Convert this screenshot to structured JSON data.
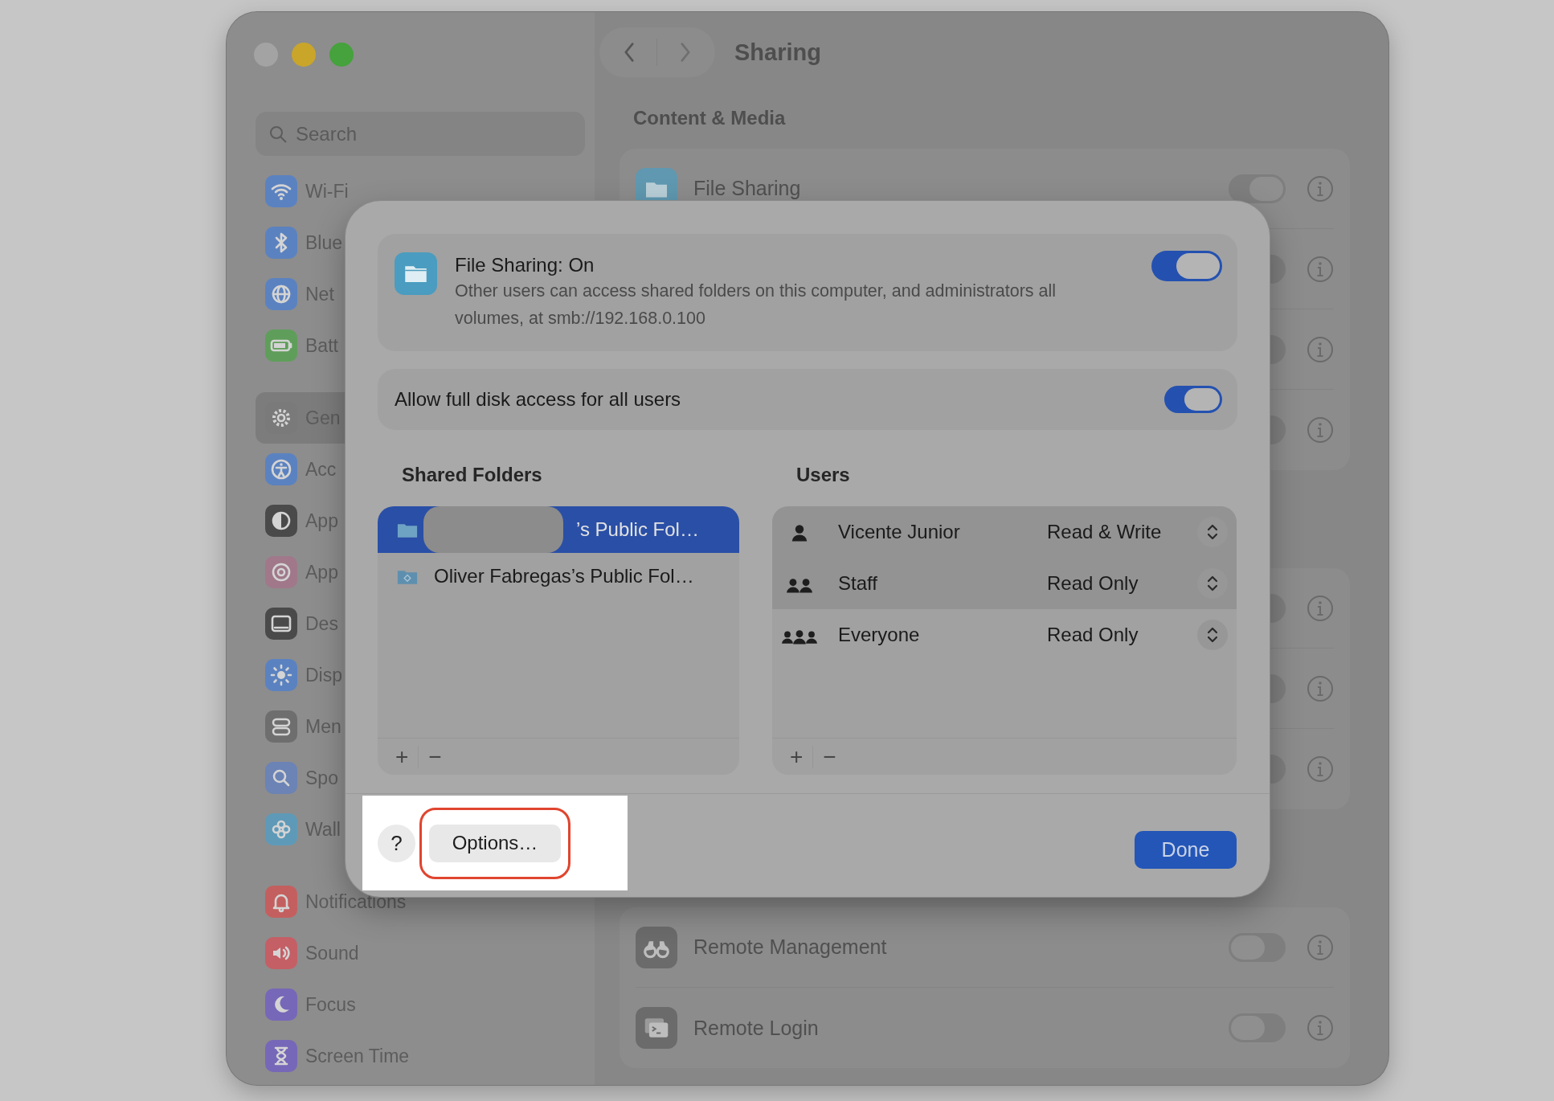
{
  "sidebar": {
    "search": {
      "placeholder": "Search"
    },
    "groups": [
      {
        "items": [
          {
            "label": "Wi-Fi",
            "kind": "wifi",
            "color": "#5b82c0",
            "selected": false
          },
          {
            "label": "Blue",
            "kind": "bluetooth",
            "color": "#5b82c0",
            "selected": false
          },
          {
            "label": "Net",
            "kind": "globe",
            "color": "#5b82c0",
            "selected": false
          },
          {
            "label": "Batt",
            "kind": "battery",
            "color": "#5f9e5a",
            "selected": false
          }
        ]
      },
      {
        "items": [
          {
            "label": "Gen",
            "kind": "gear",
            "color": "#7a7a7a",
            "selected": true
          },
          {
            "label": "Acc",
            "kind": "accessibility",
            "color": "#5b82c0",
            "selected": false
          },
          {
            "label": "App",
            "kind": "appearance",
            "color": "#4a4a4a",
            "selected": false
          },
          {
            "label": "App",
            "kind": "intelligence",
            "color": "#a0788a",
            "selected": false
          },
          {
            "label": "Des",
            "kind": "dock",
            "color": "#4a4a4a",
            "selected": false
          },
          {
            "label": "Disp",
            "kind": "sun",
            "color": "#5b82c0",
            "selected": false
          },
          {
            "label": "Men",
            "kind": "toggles",
            "color": "#6e6e6e",
            "selected": false
          },
          {
            "label": "Spo",
            "kind": "spotlight",
            "color": "#6b83b5",
            "selected": false
          },
          {
            "label": "Wall",
            "kind": "flower",
            "color": "#5e9ab8",
            "selected": false
          }
        ]
      },
      {
        "items": [
          {
            "label": "Notifications",
            "kind": "bell",
            "color": "#c45f5f",
            "selected": false
          },
          {
            "label": "Sound",
            "kind": "speaker",
            "color": "#c45f66",
            "selected": false
          },
          {
            "label": "Focus",
            "kind": "moon",
            "color": "#7767b8",
            "selected": false
          },
          {
            "label": "Screen Time",
            "kind": "hourglass",
            "color": "#7767b8",
            "selected": false
          }
        ]
      }
    ]
  },
  "header": {
    "title": "Sharing",
    "navigation": [
      {
        "kind": "back",
        "disabled": false
      },
      {
        "kind": "forward",
        "disabled": true
      }
    ]
  },
  "sections": [
    {
      "title": "Content & Media",
      "rows": [
        {
          "label": "File Sharing",
          "kind": "folder",
          "on": true
        },
        {
          "on": false
        },
        {
          "on": false
        },
        {
          "on": false
        }
      ]
    },
    {
      "rows": [
        {
          "on": false
        },
        {
          "on": false
        },
        {
          "on": false
        }
      ]
    },
    {
      "rows": [
        {
          "label": "Remote Management",
          "kind": "binoculars",
          "on": false
        },
        {
          "label": "Remote Login",
          "kind": "terminal",
          "on": false
        }
      ]
    }
  ],
  "dialog": {
    "service": {
      "title": "File Sharing: On",
      "description": "Other users can access shared folders on this computer, and administrators all volumes, at smb://192.168.0.100",
      "on": true
    },
    "full_disk_access": {
      "label": "Allow full disk access for all users",
      "on": true
    },
    "shared_folders": {
      "title": "Shared Folders",
      "items": [
        {
          "name": "’s Public Fol…",
          "kind": "folder",
          "selected": true,
          "redacted": true
        },
        {
          "name": "Oliver Fabregas’s Public Fol…",
          "kind": "shared-folder",
          "selected": false,
          "redacted": false
        }
      ],
      "buttons": [
        "+",
        "−"
      ]
    },
    "users": {
      "title": "Users",
      "items": [
        {
          "name": "Vicente Junior",
          "kind": "user",
          "permission": "Read & Write",
          "shaded": true
        },
        {
          "name": "Staff",
          "kind": "group",
          "permission": "Read Only",
          "shaded": true
        },
        {
          "name": "Everyone",
          "kind": "everyone",
          "permission": "Read Only",
          "shaded": false
        }
      ],
      "buttons": [
        "+",
        "−"
      ]
    },
    "help": "?",
    "options": {
      "label": "Options…",
      "highlighted": true
    },
    "done": "Done"
  }
}
